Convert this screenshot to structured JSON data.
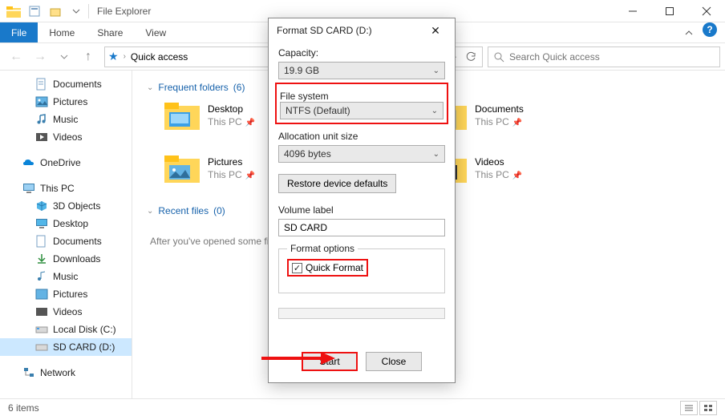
{
  "window": {
    "title": "File Explorer"
  },
  "ribbon": {
    "file": "File",
    "home": "Home",
    "share": "Share",
    "view": "View"
  },
  "address": {
    "location": "Quick access"
  },
  "search": {
    "placeholder": "Search Quick access"
  },
  "sidebar": {
    "quick": [
      {
        "label": "Documents",
        "icon": "documents"
      },
      {
        "label": "Pictures",
        "icon": "pictures"
      },
      {
        "label": "Music",
        "icon": "music"
      },
      {
        "label": "Videos",
        "icon": "videos"
      }
    ],
    "onedrive": "OneDrive",
    "thispc": "This PC",
    "pc": [
      {
        "label": "3D Objects"
      },
      {
        "label": "Desktop"
      },
      {
        "label": "Documents"
      },
      {
        "label": "Downloads"
      },
      {
        "label": "Music"
      },
      {
        "label": "Pictures"
      },
      {
        "label": "Videos"
      },
      {
        "label": "Local Disk (C:)"
      },
      {
        "label": "SD CARD (D:)"
      }
    ],
    "network": "Network"
  },
  "sections": {
    "frequent": {
      "title": "Frequent folders",
      "count": "(6)"
    },
    "recent": {
      "title": "Recent files",
      "count": "(0)",
      "note": "After you've opened some files, we'll show the most recent ones here."
    }
  },
  "folders": {
    "left": [
      {
        "name": "Desktop",
        "sub": "This PC"
      },
      {
        "name": "Pictures",
        "sub": "This PC"
      }
    ],
    "right": [
      {
        "name": "Documents",
        "sub": "This PC"
      },
      {
        "name": "Videos",
        "sub": "This PC"
      }
    ]
  },
  "statusbar": {
    "items": "6 items"
  },
  "dialog": {
    "title": "Format SD CARD (D:)",
    "capacity_label": "Capacity:",
    "capacity_value": "19.9 GB",
    "filesystem_label": "File system",
    "filesystem_value": "NTFS (Default)",
    "alloc_label": "Allocation unit size",
    "alloc_value": "4096 bytes",
    "restore": "Restore device defaults",
    "volume_label": "Volume label",
    "volume_value": "SD CARD",
    "format_options": "Format options",
    "quick_format": "Quick Format",
    "start": "Start",
    "close": "Close"
  }
}
